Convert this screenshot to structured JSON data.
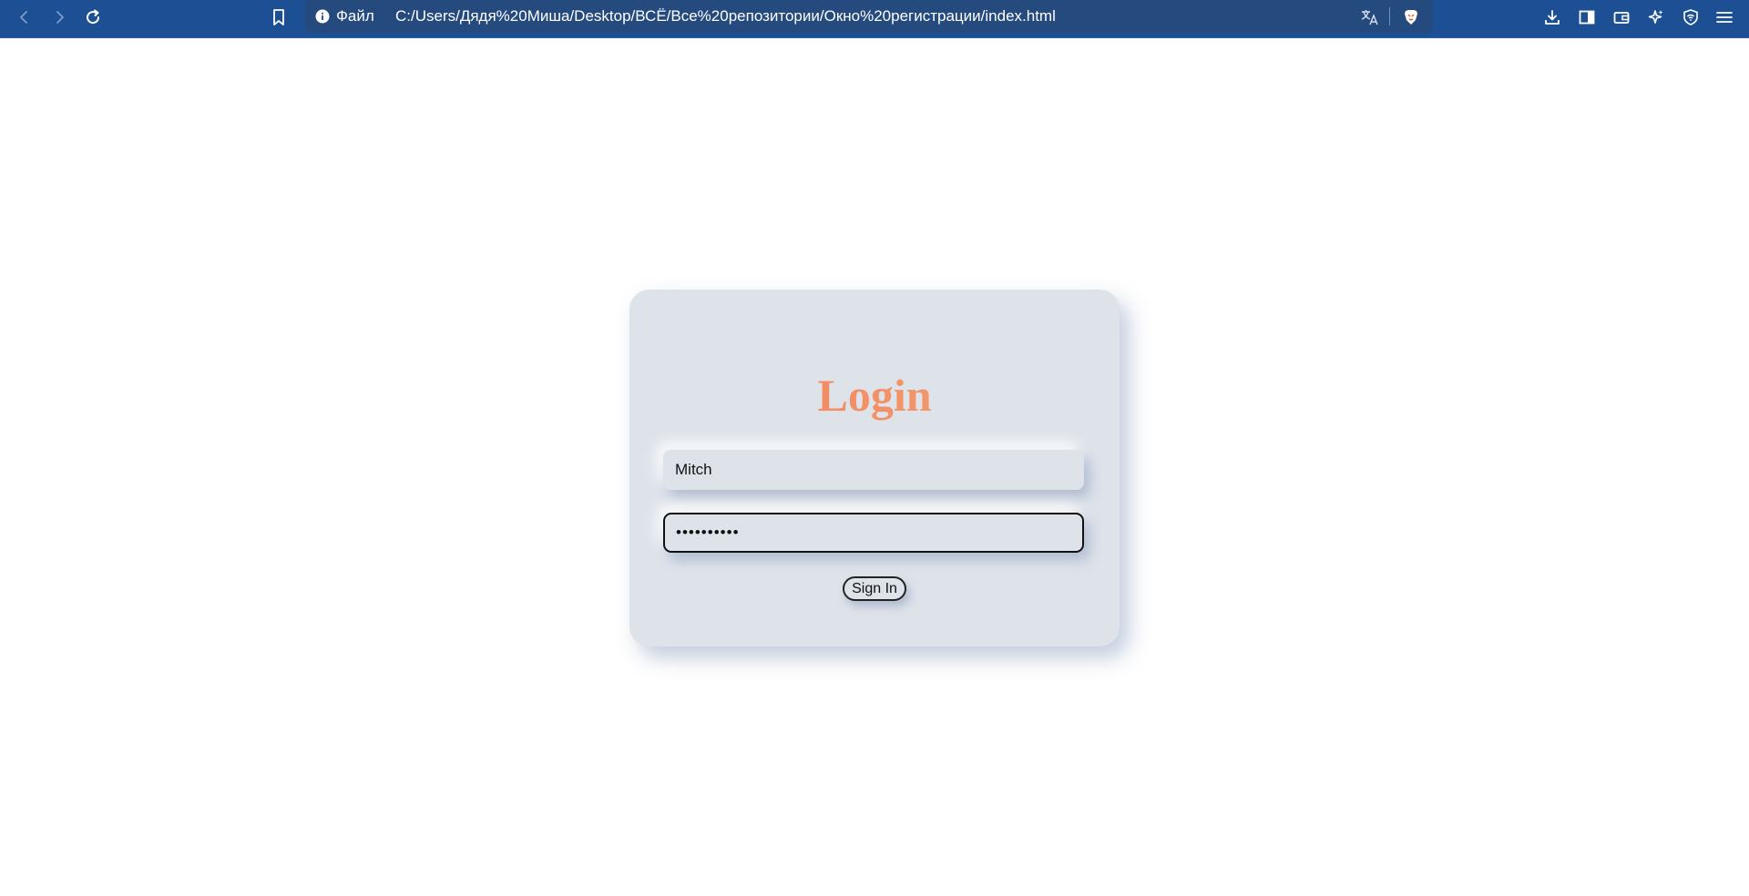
{
  "browser": {
    "address_scheme": "Файл",
    "address_url": "C:/Users/Дядя%20Миша/Desktop/ВСЁ/Все%20репозитории/Окно%20регистрации/index.html",
    "toolbar_color": "#1c4f93",
    "icons": {
      "back": "chevron-left-icon",
      "forward": "chevron-right-icon",
      "reload": "reload-icon",
      "bookmark": "bookmark-icon",
      "site_info": "info-icon",
      "translate": "translate-icon",
      "brave_shields": "brave-lion-icon",
      "downloads": "download-icon",
      "sidebar": "sidebar-icon",
      "wallet": "wallet-icon",
      "leo": "sparkle-icon",
      "vpn": "shield-wifi-icon",
      "menu": "hamburger-menu-icon"
    }
  },
  "login_form": {
    "title": "Login",
    "title_gradient": [
      "#f27b5b",
      "#f2a673"
    ],
    "username_value": "Mitch",
    "password_value": "••••••••••",
    "submit_label": "Sign In",
    "card_color": "#dee3ea"
  }
}
